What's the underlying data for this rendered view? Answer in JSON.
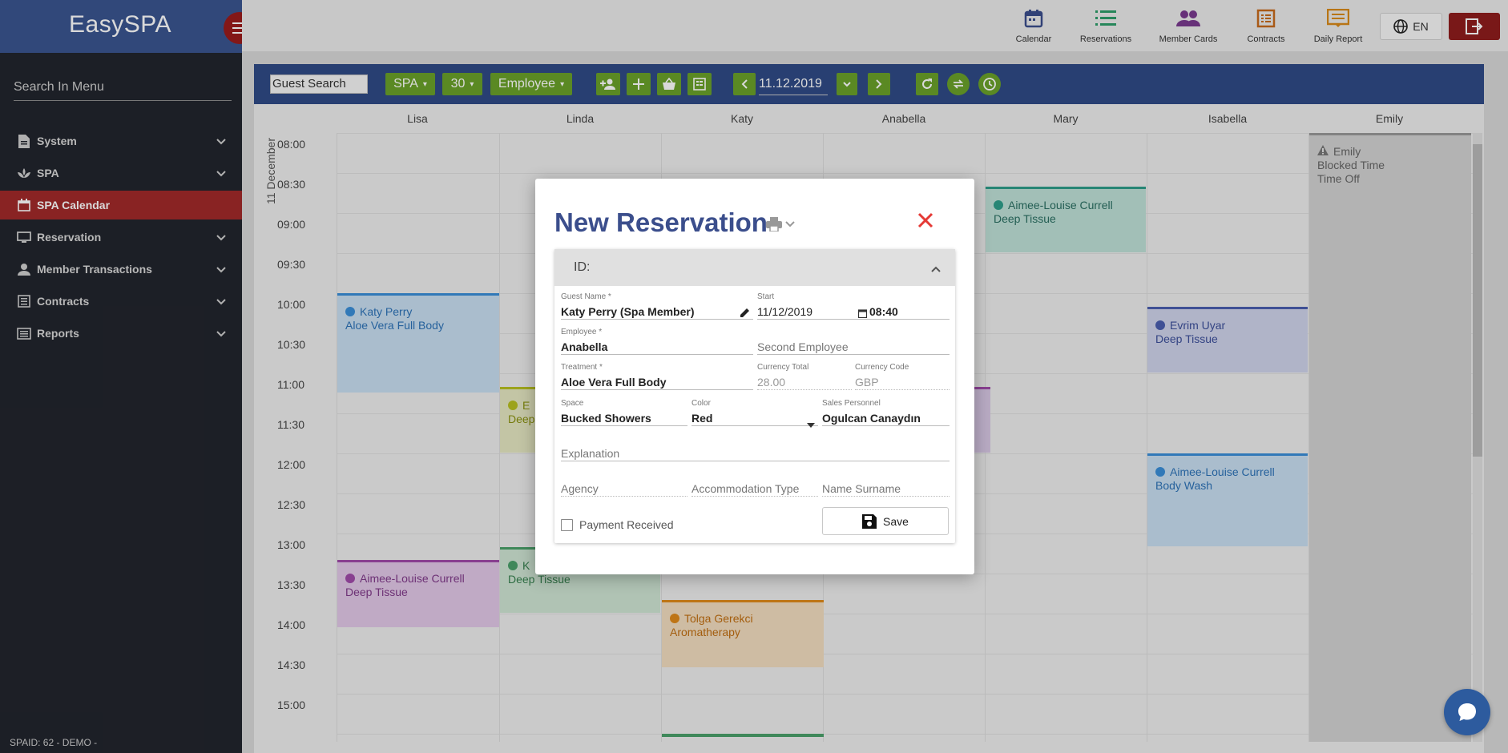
{
  "app": {
    "title": "EasySPA",
    "footer": "SPAID: 62 - DEMO -"
  },
  "sidebar": {
    "search_placeholder": "Search In Menu",
    "items": [
      {
        "label": "System",
        "icon": "document-icon",
        "expandable": true
      },
      {
        "label": "SPA",
        "icon": "spa-icon",
        "expandable": true
      },
      {
        "label": "SPA Calendar",
        "icon": "calendar-icon",
        "active": true
      },
      {
        "label": "Reservation",
        "icon": "monitor-icon",
        "expandable": true
      },
      {
        "label": "Member Transactions",
        "icon": "person-icon",
        "expandable": true
      },
      {
        "label": "Contracts",
        "icon": "list-icon",
        "expandable": true
      },
      {
        "label": "Reports",
        "icon": "report-icon",
        "expandable": true
      }
    ]
  },
  "topnav": {
    "items": [
      {
        "label": "Calendar",
        "icon": "calendar-icon",
        "color": "#3b4e8c"
      },
      {
        "label": "Reservations",
        "icon": "list-icon",
        "color": "#2e9e6a"
      },
      {
        "label": "Member Cards",
        "icon": "people-icon",
        "color": "#7a3a8f"
      },
      {
        "label": "Contracts",
        "icon": "contract-icon",
        "color": "#c76a1c"
      },
      {
        "label": "Daily Report",
        "icon": "report-icon",
        "color": "#d98a1a"
      }
    ],
    "language": "EN"
  },
  "toolbar": {
    "guest_search_placeholder": "Guest Search",
    "spa_select": "SPA",
    "interval_select": "30",
    "view_select": "Employee",
    "date": "11.12.2019"
  },
  "calendar": {
    "day_label": "11 December",
    "employees": [
      "Lisa",
      "Linda",
      "Katy",
      "Anabella",
      "Mary",
      "Isabella",
      "Emily"
    ],
    "times": [
      "08:00",
      "08:30",
      "09:00",
      "09:30",
      "10:00",
      "10:30",
      "11:00",
      "11:30",
      "12:00",
      "12:30",
      "13:00",
      "13:30",
      "14:00",
      "14:30",
      "15:00"
    ],
    "events": [
      {
        "guest": "Aimee-Louise Currell",
        "treatment": "Deep Tissue",
        "employee": "Mary",
        "color": "#2e9e8a"
      },
      {
        "guest": "Katy Perry",
        "treatment": "Aloe Vera Full Body",
        "employee": "Lisa",
        "color": "#3a8fd9"
      },
      {
        "guest": "Evrim Uyar",
        "treatment": "Deep Tissue",
        "employee": "Isabella",
        "color": "#4a5fb0"
      },
      {
        "guest": "E",
        "treatment": "Deep",
        "employee": "Linda",
        "color": "#b8c020"
      },
      {
        "guest": "Aimee-Louise Currell",
        "treatment": "Body Wash",
        "employee": "Isabella",
        "color": "#3a8fd9"
      },
      {
        "guest": "Aimee-Louise Currell",
        "treatment": "Deep Tissue",
        "employee": "Lisa",
        "color": "#a04aaa"
      },
      {
        "guest": "K",
        "treatment": "Deep Tissue",
        "employee": "Linda",
        "color": "#4aa06a"
      },
      {
        "guest": "Tolga Gerekci",
        "treatment": "Aromatherapy",
        "employee": "Katy",
        "color": "#e08a1a"
      }
    ],
    "blocked": {
      "name": "Emily",
      "line1": "Blocked Time",
      "line2": "Time Off"
    }
  },
  "modal": {
    "title": "New Reservation",
    "id_label": "ID:",
    "fields": {
      "guest_name": {
        "label": "Guest Name *",
        "value": "Katy Perry (Spa Member)"
      },
      "start": {
        "label": "Start",
        "date": "11/12/2019",
        "time": "08:40"
      },
      "employee": {
        "label": "Employee *",
        "value": "Anabella"
      },
      "second_employee": {
        "placeholder": "Second Employee"
      },
      "treatment": {
        "label": "Treatment *",
        "value": "Aloe Vera Full Body"
      },
      "currency_total": {
        "label": "Currency Total",
        "value": "28.00"
      },
      "currency_code": {
        "label": "Currency Code",
        "value": "GBP"
      },
      "space": {
        "label": "Space",
        "value": "Bucked Showers"
      },
      "color": {
        "label": "Color",
        "value": "Red"
      },
      "sales_personnel": {
        "label": "Sales Personnel",
        "value": "Ogulcan Canaydın"
      },
      "explanation": {
        "placeholder": "Explanation"
      },
      "agency": {
        "placeholder": "Agency"
      },
      "accommodation_type": {
        "placeholder": "Accommodation Type"
      },
      "name_surname": {
        "placeholder": "Name Surname"
      }
    },
    "payment_received": "Payment Received",
    "save_label": "Save"
  }
}
